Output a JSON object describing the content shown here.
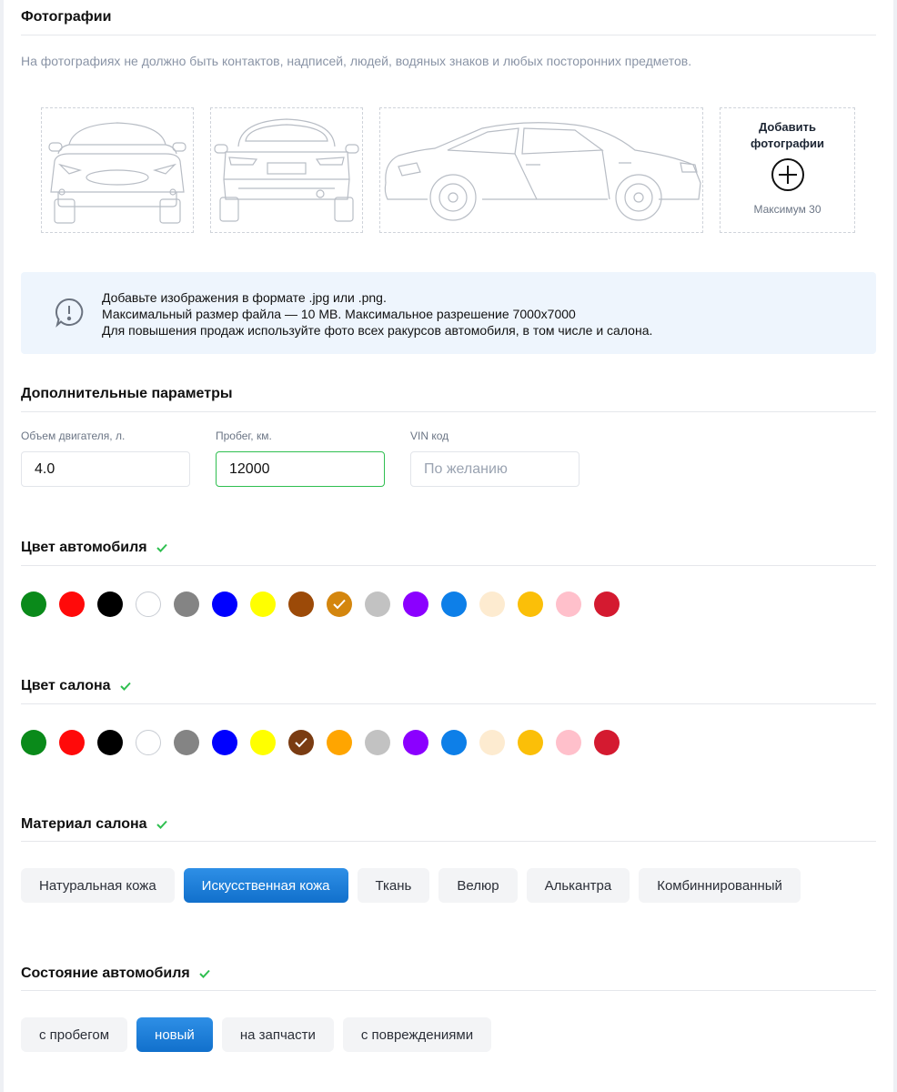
{
  "photos": {
    "title": "Фотографии",
    "note": "На фотографиях не должно быть контактов, надписей, людей, водяных знаков и любых посторонних предметов.",
    "add_title": "Добавить фотографии",
    "max_label": "Максимум 30"
  },
  "info": {
    "lines": [
      "Добавьте изображения в формате .jpg или .png.",
      "Максимальный размер файла — 10 MB. Максимальное разрешение 7000x7000",
      "Для повышения продаж используйте фото всех ракурсов автомобиля, в том числе и салона."
    ]
  },
  "extra": {
    "title": "Дополнительные параметры",
    "fields": [
      {
        "label": "Объем двигателя, л.",
        "value": "4.0",
        "placeholder": ""
      },
      {
        "label": "Пробег, км.",
        "value": "12000",
        "placeholder": ""
      },
      {
        "label": "VIN код",
        "value": "",
        "placeholder": "По желанию"
      }
    ]
  },
  "car_color": {
    "title": "Цвет автомобиля",
    "selected_index": 8,
    "colors": [
      "#0a8a1a",
      "#ff0a0a",
      "#000000",
      "#ffffff",
      "#848484",
      "#0000ff",
      "#ffff00",
      "#9c4a08",
      "#d4860e",
      "#c2c2c2",
      "#8b00ff",
      "#0d7fe8",
      "#fdebd0",
      "#fbbf08",
      "#ffc0cb",
      "#d41a30"
    ]
  },
  "interior_color": {
    "title": "Цвет салона",
    "selected_index": 7,
    "colors": [
      "#0a8a1a",
      "#ff0a0a",
      "#000000",
      "#ffffff",
      "#848484",
      "#0000ff",
      "#ffff00",
      "#7a3c12",
      "#ffa500",
      "#c2c2c2",
      "#8b00ff",
      "#0d7fe8",
      "#fdebd0",
      "#fbbf08",
      "#ffc0cb",
      "#d41a30"
    ]
  },
  "material": {
    "title": "Материал салона",
    "selected_index": 1,
    "options": [
      "Натуральная кожа",
      "Искусственная кожа",
      "Ткань",
      "Велюр",
      "Алькантра",
      "Комбиннированный"
    ]
  },
  "condition": {
    "title": "Состояние автомобиля",
    "selected_index": 1,
    "options": [
      "с пробегом",
      "новый",
      "на запчасти",
      "с повреждениями"
    ]
  },
  "colors": {
    "accent": "#1a7fd8",
    "check": "#2fbf50",
    "info_bg": "#eef5fd"
  }
}
